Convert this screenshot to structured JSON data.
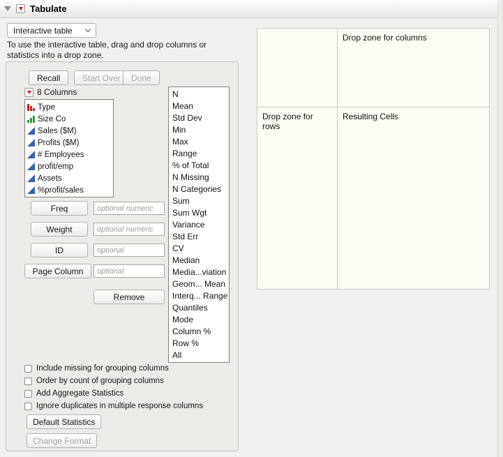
{
  "title": "Tabulate",
  "mode_dropdown": {
    "value": "Interactive table"
  },
  "help_text": "To use the interactive table, drag and drop columns or statistics into a drop zone.",
  "buttons": {
    "recall": "Recall",
    "start_over": "Start Over",
    "done": "Done",
    "remove": "Remove",
    "default_statistics": "Default Statistics",
    "change_format": "Change Format"
  },
  "columns_panel": {
    "header": "8 Columns",
    "items": [
      {
        "label": "Type",
        "icon": "nominal-icon"
      },
      {
        "label": "Size Co",
        "icon": "ordinal-icon"
      },
      {
        "label": "Sales ($M)",
        "icon": "continuous-icon"
      },
      {
        "label": "Profits ($M)",
        "icon": "continuous-icon"
      },
      {
        "label": "# Employees",
        "icon": "continuous-icon"
      },
      {
        "label": "profit/emp",
        "icon": "continuous-icon"
      },
      {
        "label": "Assets",
        "icon": "continuous-icon"
      },
      {
        "label": "%profit/sales",
        "icon": "continuous-icon"
      }
    ]
  },
  "fields": [
    {
      "button": "Freq",
      "placeholder": "optional numeric"
    },
    {
      "button": "Weight",
      "placeholder": "optional numeric"
    },
    {
      "button": "ID",
      "placeholder": "optional"
    },
    {
      "button": "Page Column",
      "placeholder": "optional"
    }
  ],
  "statistics": [
    "N",
    "Mean",
    "Std Dev",
    "Min",
    "Max",
    "Range",
    "% of Total",
    "N Missing",
    "N Categories",
    "Sum",
    "Sum Wgt",
    "Variance",
    "Std Err",
    "CV",
    "Median",
    "Media...viation",
    "Geom... Mean",
    "Interq... Range",
    "Quantiles",
    "Mode",
    "Column %",
    "Row %",
    "All"
  ],
  "checkboxes": [
    "Include missing for grouping columns",
    "Order by count of grouping columns",
    "Add Aggregate Statistics",
    "Ignore duplicates in multiple response columns"
  ],
  "drop_zones": {
    "columns": "Drop zone for columns",
    "rows": "Drop zone for rows",
    "cells": "Resulting Cells"
  },
  "colors": {
    "red_triangle": "#c41e1e",
    "nominal": "#cc2222",
    "ordinal": "#2f9e2f",
    "continuous": "#3465a8"
  }
}
